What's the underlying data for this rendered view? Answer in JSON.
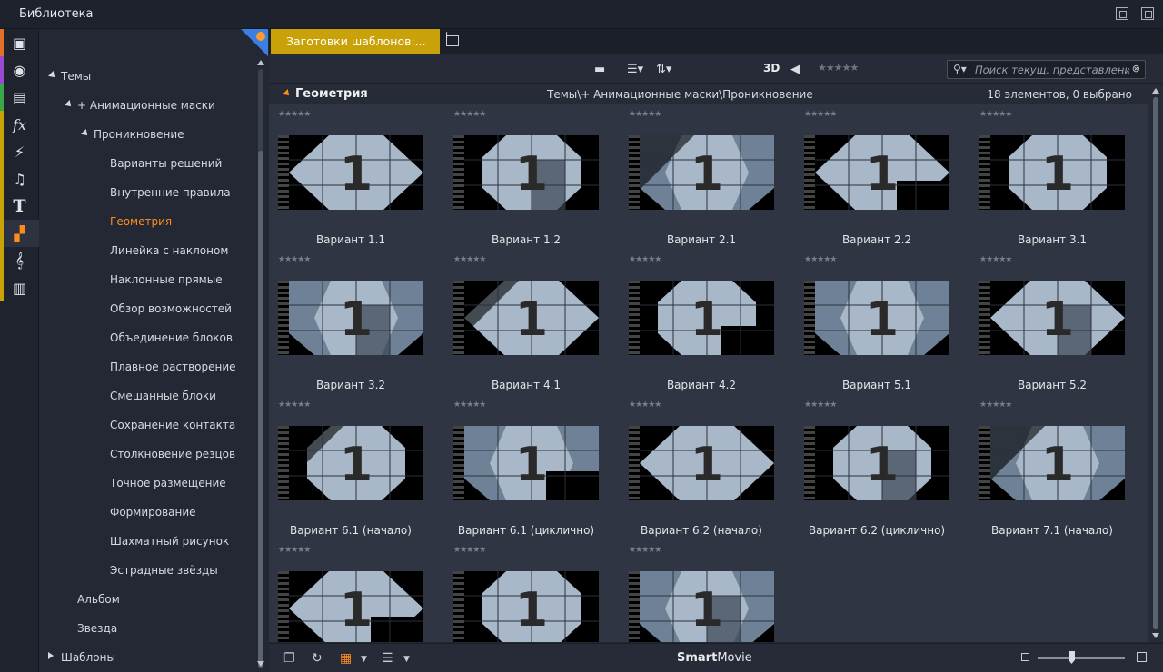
{
  "window": {
    "title": "Библиотека"
  },
  "sidebar_icons": [
    {
      "name": "library-box-icon",
      "glyph": "▣",
      "accent": "#e0702a"
    },
    {
      "name": "film-reel-icon",
      "glyph": "◉",
      "accent": "#9a4ad0"
    },
    {
      "name": "photos-icon",
      "glyph": "▤",
      "accent": "#3aa64a"
    },
    {
      "name": "effects-fx-icon",
      "glyph": "fx",
      "accent": "#c9a20a"
    },
    {
      "name": "transition-lightning-icon",
      "glyph": "⚡",
      "accent": "#c9a20a"
    },
    {
      "name": "music-note-icon",
      "glyph": "♫",
      "accent": "#c9a20a"
    },
    {
      "name": "title-text-icon",
      "glyph": "T",
      "accent": "#c9a20a"
    },
    {
      "name": "templates-icon",
      "glyph": "▞",
      "accent": "#c9a20a"
    },
    {
      "name": "treble-clef-icon",
      "glyph": "𝄞",
      "accent": "#c9a20a"
    },
    {
      "name": "piano-icon",
      "glyph": "▥",
      "accent": "#c9a20a"
    }
  ],
  "tree": {
    "root": "Темы",
    "masks": "+ Анимационные маски",
    "penetration": "Проникновение",
    "items": [
      "Варианты решений",
      "Внутренние правила",
      "Геометрия",
      "Линейка с наклоном",
      "Наклонные прямые",
      "Обзор возможностей",
      "Объединение блоков",
      "Плавное растворение",
      "Смешанные блоки",
      "Сохранение контакта",
      "Столкновение резцов",
      "Точное размещение",
      "Формирование",
      "Шахматный рисунок",
      "Эстрадные звёзды"
    ],
    "selected_index": 2,
    "album": "Альбом",
    "star": "Звезда",
    "templates": "Шаблоны"
  },
  "tab": {
    "label": "Заготовки шаблонов:..."
  },
  "toolbar": {
    "label_3d": "3D",
    "rating": "★★★★★",
    "search_placeholder": "Поиск текущ. представления",
    "clear": "⊗"
  },
  "pathbar": {
    "group": "Геометрия",
    "path": "Темы\\+ Анимационные маски\\Проникновение",
    "count": "18 элементов, 0 выбрано"
  },
  "grid": {
    "rating": "★★★★★",
    "items": [
      {
        "name": "Вариант 1.1"
      },
      {
        "name": "Вариант 1.2"
      },
      {
        "name": "Вариант 2.1"
      },
      {
        "name": "Вариант 2.2"
      },
      {
        "name": "Вариант 3.1"
      },
      {
        "name": "Вариант 3.2"
      },
      {
        "name": "Вариант 4.1"
      },
      {
        "name": "Вариант 4.2"
      },
      {
        "name": "Вариант 5.1"
      },
      {
        "name": "Вариант 5.2"
      },
      {
        "name": "Вариант 6.1 (начало)"
      },
      {
        "name": "Вариант 6.1 (циклично)"
      },
      {
        "name": "Вариант 6.2 (начало)"
      },
      {
        "name": "Вариант 6.2 (циклично)"
      },
      {
        "name": "Вариант 7.1 (начало)"
      },
      {
        "name": ""
      },
      {
        "name": ""
      },
      {
        "name": ""
      }
    ],
    "thumb_digit": "1"
  },
  "bottombar": {
    "brand_bold": "Smart",
    "brand_rest": "Movie"
  },
  "colors": {
    "accent_orange": "#ff8c1a",
    "tab_gold": "#c9a20a",
    "pin_blue": "#3d7fe0"
  }
}
